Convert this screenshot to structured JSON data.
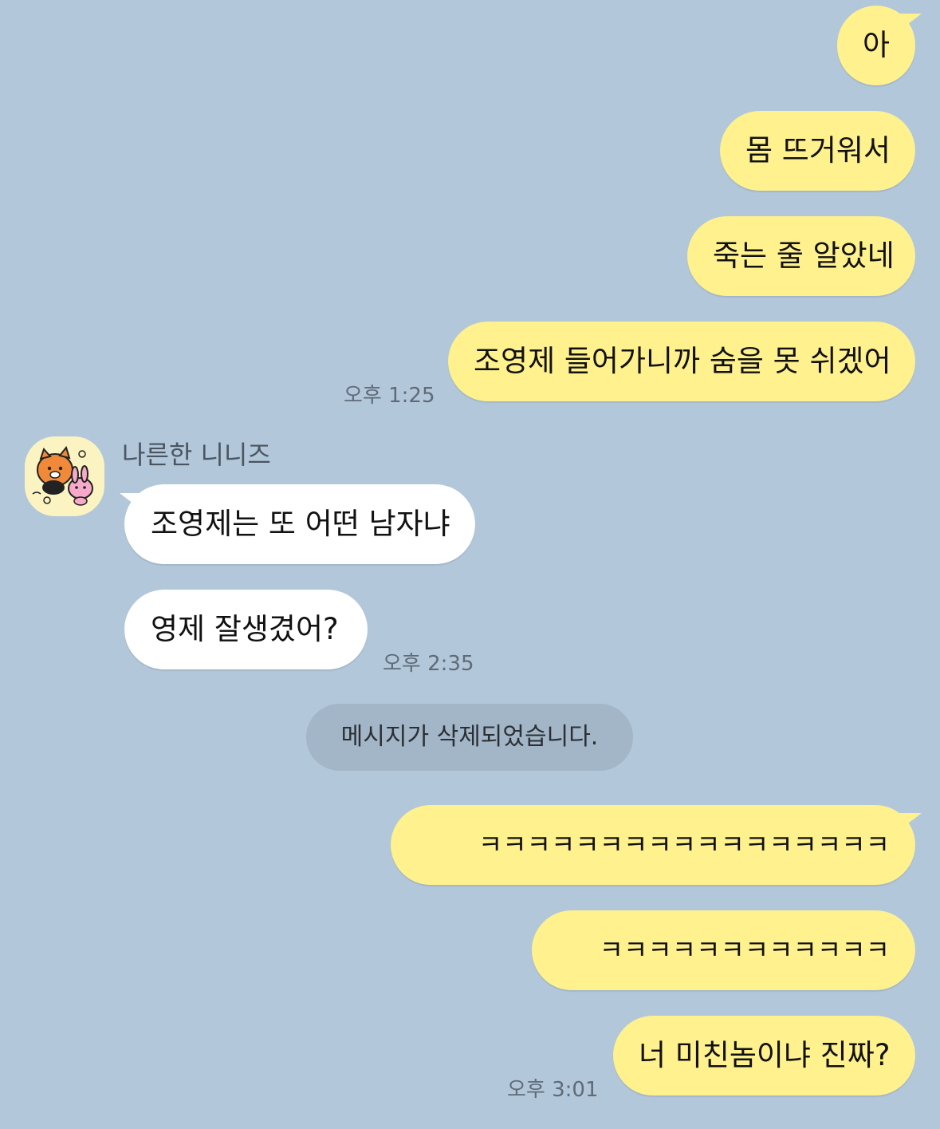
{
  "messages_top": {
    "m1": "아",
    "m2": "몸 뜨거워서",
    "m3": "죽는 줄 알았네",
    "m4": "조영제 들어가니까 숨을 못 쉬겠어",
    "time1": "오후 1:25"
  },
  "friend": {
    "name": "나른한 니니즈",
    "m1": "조영제는 또 어떤 남자냐",
    "m2": "영제 잘생겼어?",
    "time": "오후 2:35",
    "avatar_icon": "sticker-avatar"
  },
  "system_notice": "메시지가 삭제되었습니다.",
  "messages_bottom": {
    "m1": "ㅋㅋㅋㅋㅋㅋㅋㅋㅋㅋㅋㅋㅋㅋㅋㅋㅋ",
    "m2": "ㅋㅋㅋㅋㅋㅋㅋㅋㅋㅋㅋㅋ",
    "m3": "너 미친놈이냐 진짜?",
    "time": "오후 3:01"
  },
  "colors": {
    "background": "#b2c7da",
    "my_bubble": "#fef18e",
    "their_bubble": "#ffffff",
    "system_bubble": "#a2b6c8"
  }
}
